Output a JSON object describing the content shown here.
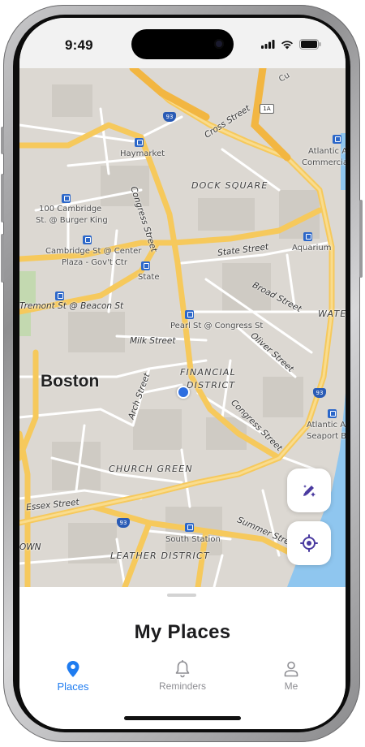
{
  "status_bar": {
    "time": "9:49"
  },
  "map": {
    "city_label": "Boston",
    "districts": [
      "DOCK SQUARE",
      "FINANCIAL",
      "DISTRICT",
      "CHURCH GREEN",
      "LEATHER DISTRICT",
      "WATE"
    ],
    "streets": [
      "Cross Street",
      "Congress Street",
      "State Street",
      "Broad Street",
      "Milk Street",
      "Oliver Street",
      "Arch Street",
      "Congress Street",
      "Essex Street",
      "Summer Stre",
      "Tremont St @ Beacon St",
      "OWN"
    ],
    "stops": [
      "Haymarket",
      "100 Cambridge",
      "St. @ Burger King",
      "Cambridge St @ Center",
      "Plaza - Gov't Ctr",
      "State",
      "Pearl St @ Congress St",
      "South Station",
      "Aquarium",
      "Atlantic Av",
      "Commercial",
      "Atlantic Av",
      "Seaport Bl"
    ],
    "highways": [
      "93",
      "1A",
      "93",
      "93"
    ],
    "edge_labels": [
      "Cu"
    ]
  },
  "buttons": {
    "edit_icon": "pencil-sparkle-icon",
    "locate_icon": "location-target-icon"
  },
  "sheet": {
    "title": "My Places"
  },
  "tabs": [
    {
      "label": "Places",
      "icon": "location-pin-icon",
      "active": true
    },
    {
      "label": "Reminders",
      "icon": "bell-icon",
      "active": false
    },
    {
      "label": "Me",
      "icon": "person-icon",
      "active": false
    }
  ],
  "colors": {
    "accent": "#1f7cf0",
    "button_icon": "#4a3aa0",
    "water": "#8fc6ef",
    "road_major": "#f6c95c"
  }
}
